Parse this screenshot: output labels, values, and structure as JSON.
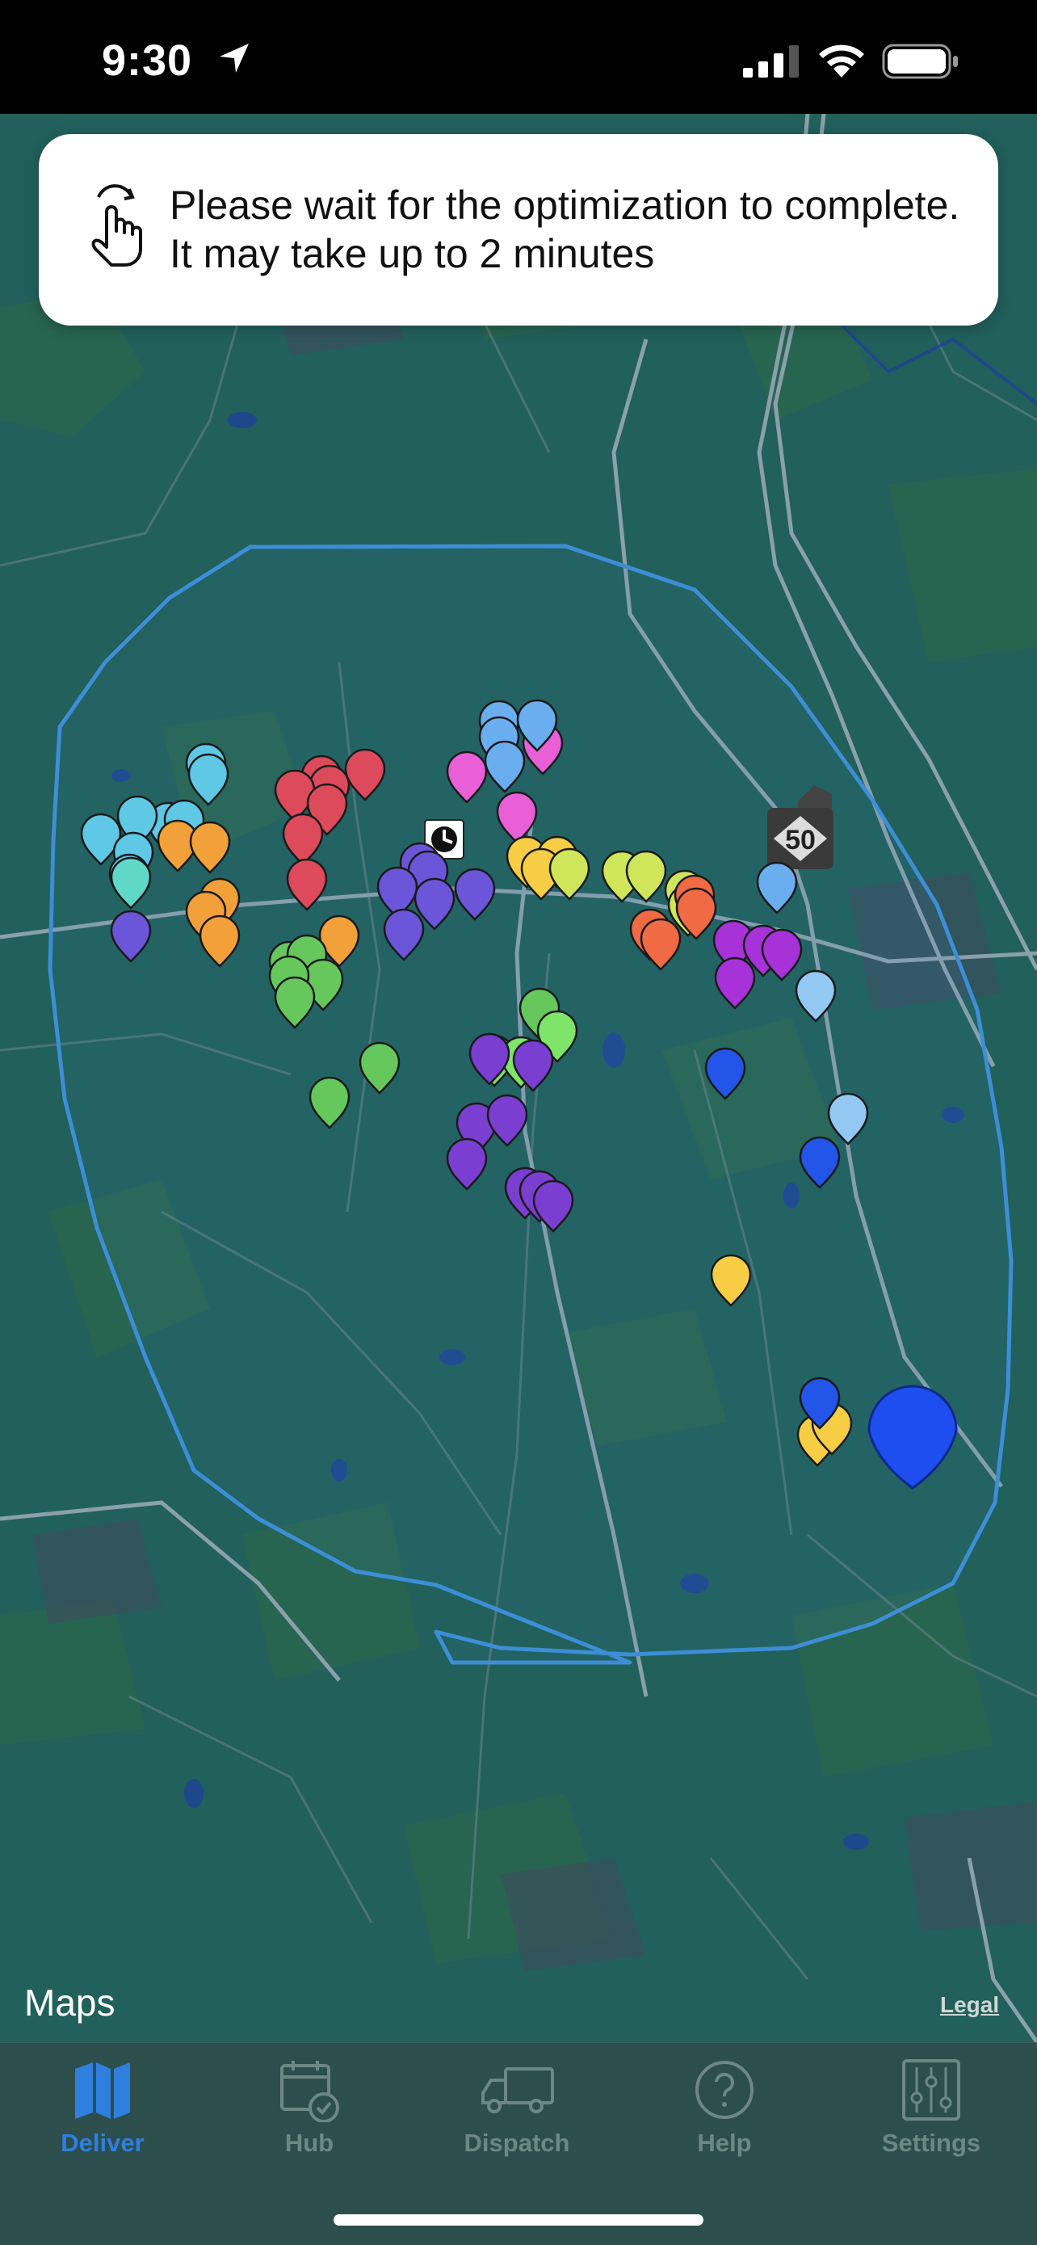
{
  "status_bar": {
    "time": "9:30",
    "location_icon": "location-arrow-icon",
    "signal_icon": "cellular-signal-icon",
    "wifi_icon": "wifi-icon",
    "battery_icon": "battery-full-icon"
  },
  "toast": {
    "icon": "hand-tap-icon",
    "message": "Please wait for the optimization to complete. It may take up to 2 minutes"
  },
  "map": {
    "route_shield": "50",
    "attribution": "Maps",
    "legal_link": "Legal",
    "stop_marker_colors": [
      "#5ec8e5",
      "#f2a03a",
      "#dc4a5c",
      "#6b55d8",
      "#66c85c",
      "#7a3fd0",
      "#e95fd8",
      "#6aaef0",
      "#f6cd45",
      "#cfe65a",
      "#f06a44",
      "#a632d8",
      "#2255e8",
      "#92c8f2",
      "#7fe46a",
      "#5fd8c8"
    ],
    "depot_marker_color": "#1f4ef0",
    "service_area_color": "#3d8ed6"
  },
  "tab_bar": {
    "tabs": [
      {
        "label": "Deliver",
        "icon": "map-icon",
        "active": true
      },
      {
        "label": "Hub",
        "icon": "calendar-check-icon",
        "active": false
      },
      {
        "label": "Dispatch",
        "icon": "truck-icon",
        "active": false
      },
      {
        "label": "Help",
        "icon": "question-circle-icon",
        "active": false
      },
      {
        "label": "Settings",
        "icon": "sliders-icon",
        "active": false
      }
    ],
    "active_color": "#2f7fdf",
    "inactive_color": "#6d8785"
  }
}
